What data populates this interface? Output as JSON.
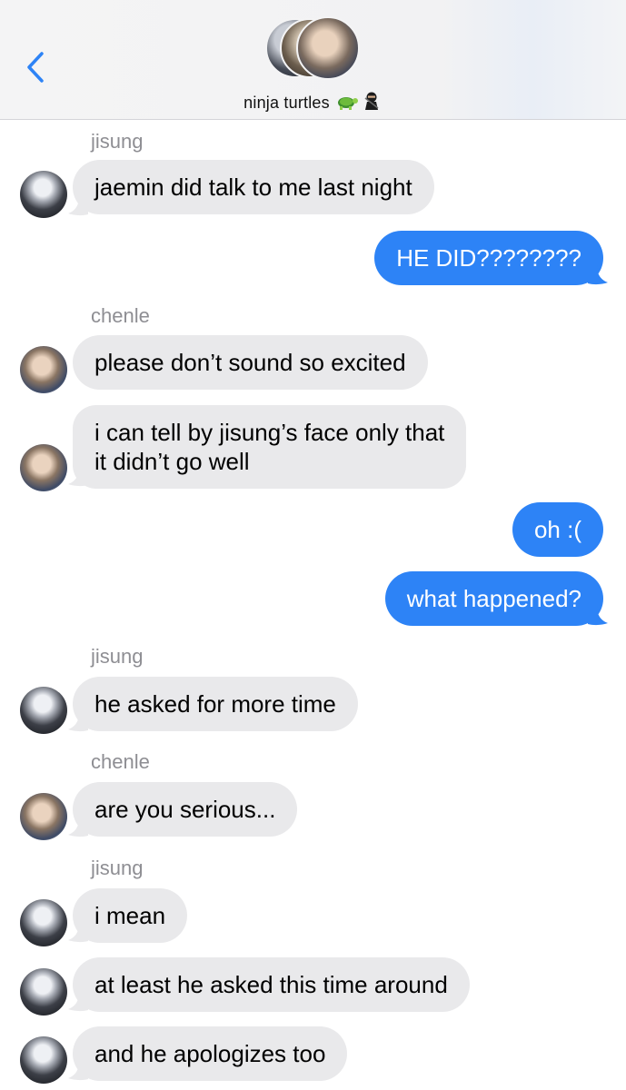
{
  "header": {
    "group_name": "ninja turtles",
    "emoji": "🐢🥷",
    "back_icon": "chevron-left-icon"
  },
  "senders": {
    "jisung": "jisung",
    "chenle": "chenle"
  },
  "messages": [
    {
      "from": "jisung",
      "text": "jaemin did talk to me last night"
    },
    {
      "from": "me",
      "text": "HE DID????????"
    },
    {
      "from": "chenle",
      "text": "please don’t sound so excited"
    },
    {
      "from": "chenle",
      "text": "i can tell by jisung’s face only that",
      "text2": "it didn’t go well"
    },
    {
      "from": "me",
      "text": "oh :("
    },
    {
      "from": "me",
      "text": "what happened?"
    },
    {
      "from": "jisung",
      "text": "he asked for more time"
    },
    {
      "from": "chenle",
      "text": "are you serious..."
    },
    {
      "from": "jisung",
      "text": "i mean"
    },
    {
      "from": "jisung",
      "text": "at least he asked this time around"
    },
    {
      "from": "jisung",
      "text": "and he apologizes too"
    }
  ],
  "colors": {
    "incoming_bubble": "#e9e9eb",
    "outgoing_bubble": "#2d83f6",
    "accent": "#2d83f6"
  }
}
